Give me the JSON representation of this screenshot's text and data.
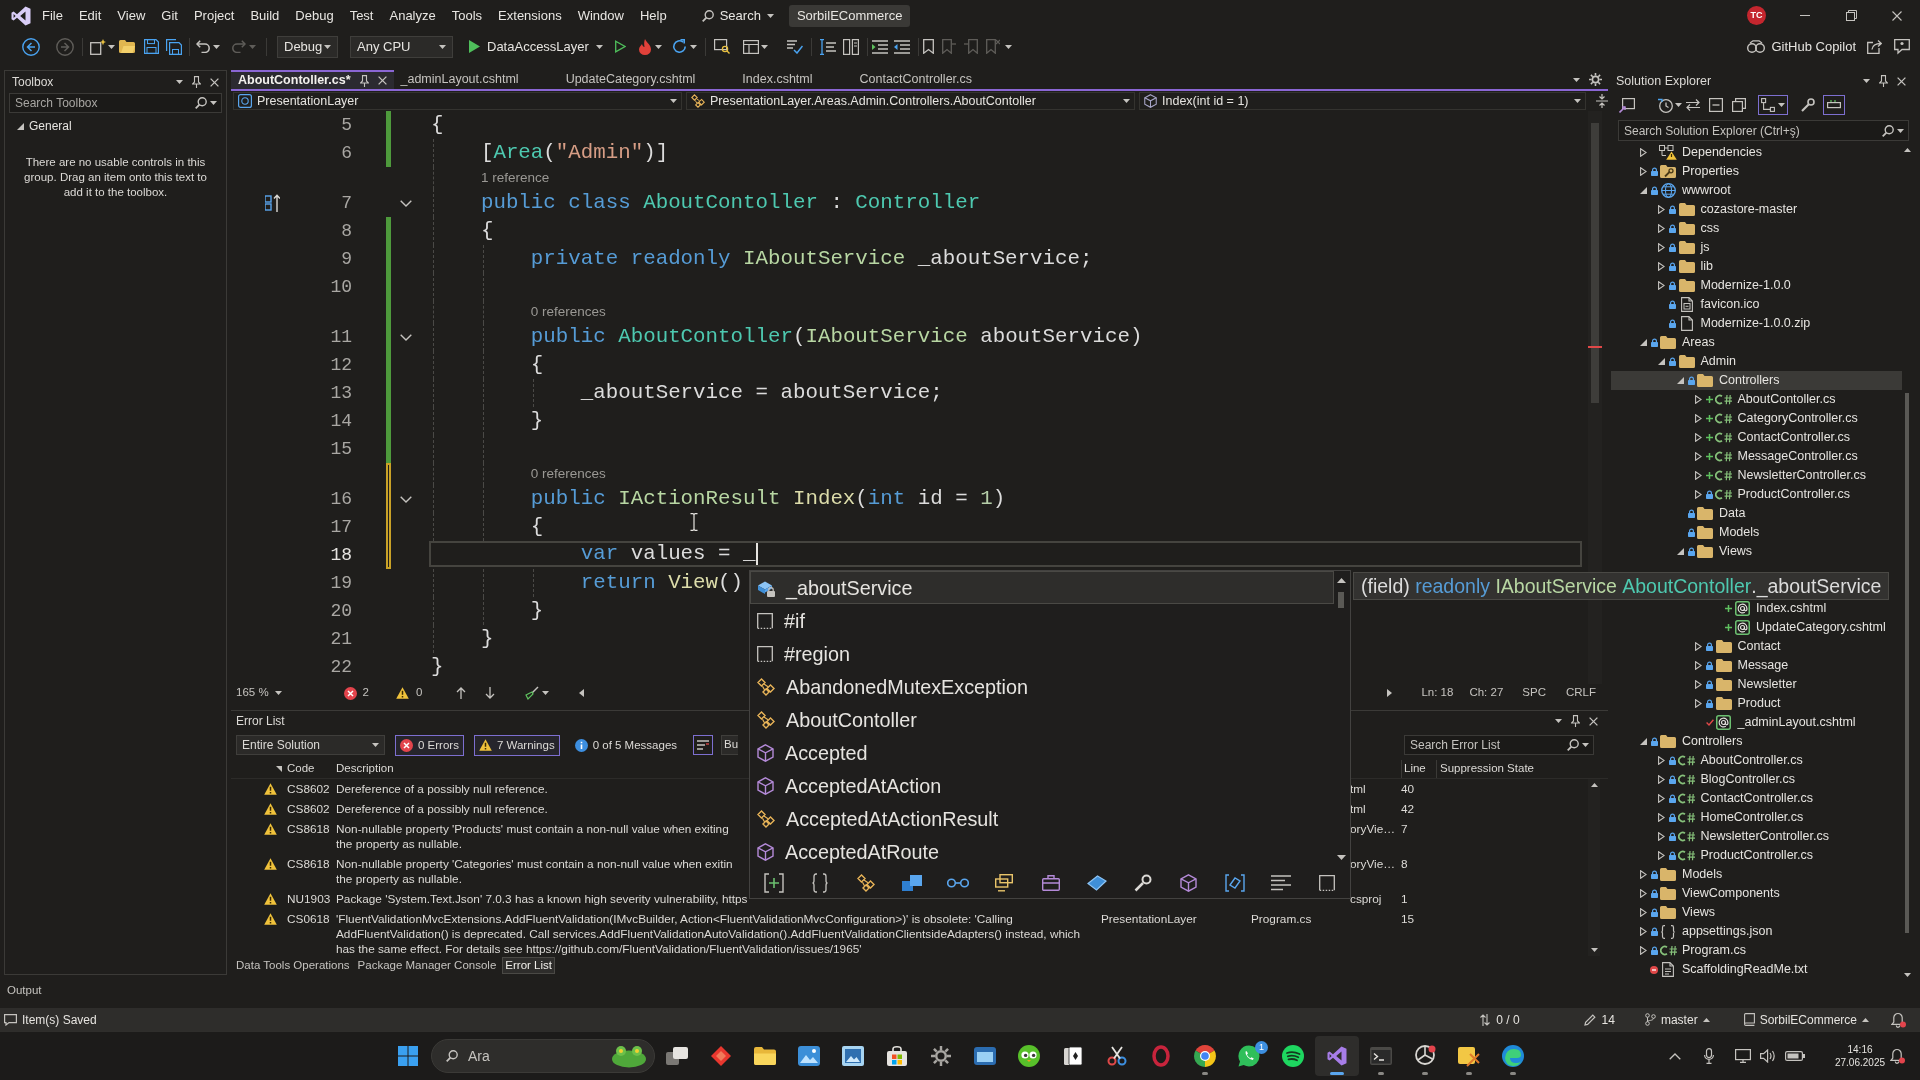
{
  "title_bar": {
    "menu": [
      "File",
      "Edit",
      "View",
      "Git",
      "Project",
      "Build",
      "Debug",
      "Test",
      "Analyze",
      "Tools",
      "Extensions",
      "Window",
      "Help"
    ],
    "search": "Search",
    "solution_name": "SorbilECommerce",
    "account_initials": "TC"
  },
  "toolbar": {
    "configuration": "Debug",
    "platform": "Any CPU",
    "startup_project": "DataAccessLayer",
    "copilot": "GitHub Copilot"
  },
  "toolbox": {
    "title": "Toolbox",
    "search_placeholder": "Search Toolbox",
    "group": {
      "label": "General",
      "expanded": true
    },
    "empty_message": "There are no usable controls in this group. Drag an item onto this text to add it to the toolbox."
  },
  "editor": {
    "tabs": [
      {
        "label": "AboutContoller.cs*",
        "selected": true
      },
      {
        "label": "_adminLayout.cshtml",
        "selected": false
      },
      {
        "label": "UpdateCategory.cshtml",
        "selected": false
      },
      {
        "label": "Index.cshtml",
        "selected": false
      },
      {
        "label": "ContactController.cs",
        "selected": false
      }
    ],
    "navigation": {
      "project": "PresentationLayer",
      "type": "PresentationLayer.Areas.Admin.Controllers.AboutContoller",
      "member": "Index(int id = 1)"
    },
    "lines": [
      {
        "kind": "code",
        "number": "5",
        "changed": true,
        "saved": true,
        "tokens": [
          {
            "text": "{",
            "kind": "plain"
          }
        ]
      },
      {
        "kind": "code",
        "number": "6",
        "changed": true,
        "saved": true,
        "tokens": [
          {
            "text": "    [",
            "kind": "plain"
          },
          {
            "text": "Area",
            "kind": "type"
          },
          {
            "text": "(",
            "kind": "plain"
          },
          {
            "text": "\"Admin\"",
            "kind": "string"
          },
          {
            "text": ")]",
            "kind": "plain"
          }
        ]
      },
      {
        "kind": "codelens",
        "text": "1 reference"
      },
      {
        "kind": "code",
        "number": "7",
        "foldable": true,
        "margin_glyph": true,
        "tokens": [
          {
            "text": "    public class ",
            "kind": "keyword"
          },
          {
            "text": "AboutContoller",
            "kind": "type"
          },
          {
            "text": " : ",
            "kind": "plain"
          },
          {
            "text": "Controller",
            "kind": "type"
          }
        ]
      },
      {
        "kind": "code",
        "number": "8",
        "changed": true,
        "saved": true,
        "tokens": [
          {
            "text": "    {",
            "kind": "plain"
          }
        ]
      },
      {
        "kind": "code",
        "number": "9",
        "changed": true,
        "saved": true,
        "tokens": [
          {
            "text": "        private readonly ",
            "kind": "keyword"
          },
          {
            "text": "IAboutService",
            "kind": "interface"
          },
          {
            "text": " _aboutService;",
            "kind": "plain"
          }
        ]
      },
      {
        "kind": "code",
        "number": "10",
        "changed": true,
        "saved": true
      },
      {
        "kind": "codelens",
        "text": "0 references",
        "changed": true,
        "saved": true
      },
      {
        "kind": "code",
        "number": "11",
        "changed": true,
        "saved": true,
        "foldable": true,
        "tokens": [
          {
            "text": "        public ",
            "kind": "keyword"
          },
          {
            "text": "AboutContoller",
            "kind": "type"
          },
          {
            "text": "(",
            "kind": "plain"
          },
          {
            "text": "IAboutService",
            "kind": "interface"
          },
          {
            "text": " aboutService)",
            "kind": "plain"
          }
        ]
      },
      {
        "kind": "code",
        "number": "12",
        "changed": true,
        "saved": true,
        "tokens": [
          {
            "text": "        {",
            "kind": "plain"
          }
        ]
      },
      {
        "kind": "code",
        "number": "13",
        "changed": true,
        "saved": true,
        "tokens": [
          {
            "text": "            _aboutService = aboutService;",
            "kind": "plain"
          }
        ]
      },
      {
        "kind": "code",
        "number": "14",
        "changed": true,
        "saved": true,
        "tokens": [
          {
            "text": "        }",
            "kind": "plain"
          }
        ]
      },
      {
        "kind": "code",
        "number": "15",
        "changed": true,
        "saved": true
      },
      {
        "kind": "codelens",
        "text": "0 references",
        "changed": true,
        "saved": false
      },
      {
        "kind": "code",
        "number": "16",
        "changed": true,
        "saved": false,
        "foldable": true,
        "tokens": [
          {
            "text": "        public ",
            "kind": "keyword"
          },
          {
            "text": "IActionResult ",
            "kind": "interface"
          },
          {
            "text": "Index",
            "kind": "method"
          },
          {
            "text": "(",
            "kind": "plain"
          },
          {
            "text": "int",
            "kind": "keyword"
          },
          {
            "text": " id = ",
            "kind": "plain"
          },
          {
            "text": "1",
            "kind": "number"
          },
          {
            "text": ")",
            "kind": "plain"
          }
        ]
      },
      {
        "kind": "code",
        "number": "17",
        "changed": true,
        "saved": false,
        "tokens": [
          {
            "text": "        {",
            "kind": "plain"
          }
        ]
      },
      {
        "kind": "code",
        "number": "18",
        "changed": true,
        "saved": false,
        "current": true,
        "tokens": [
          {
            "text": "            var",
            "kind": "keyword"
          },
          {
            "text": " values = _",
            "kind": "plain"
          }
        ]
      },
      {
        "kind": "code",
        "number": "19",
        "tokens": [
          {
            "text": "            return ",
            "kind": "keyword"
          },
          {
            "text": "View",
            "kind": "method"
          },
          {
            "text": "()",
            "kind": "plain"
          }
        ]
      },
      {
        "kind": "code",
        "number": "20",
        "tokens": [
          {
            "text": "        }",
            "kind": "plain"
          }
        ]
      },
      {
        "kind": "code",
        "number": "21",
        "tokens": [
          {
            "text": "    }",
            "kind": "plain"
          }
        ]
      },
      {
        "kind": "code",
        "number": "22",
        "tokens": [
          {
            "text": "}",
            "kind": "plain"
          }
        ]
      }
    ],
    "status": {
      "zoom": "165 %",
      "errors": "2",
      "warnings": "0",
      "line": "Ln: 18",
      "column": "Ch: 27",
      "indentation": "SPC",
      "line_ending": "CRLF"
    }
  },
  "completion": {
    "items": [
      {
        "label": "_aboutService",
        "kind": "field",
        "selected": true
      },
      {
        "label": "#if",
        "kind": "snippet",
        "selected": false
      },
      {
        "label": "#region",
        "kind": "snippet",
        "selected": false
      },
      {
        "label": "AbandonedMutexException",
        "kind": "class",
        "selected": false
      },
      {
        "label": "AboutContoller",
        "kind": "class",
        "selected": false
      },
      {
        "label": "Accepted",
        "kind": "method",
        "selected": false
      },
      {
        "label": "AcceptedAtAction",
        "kind": "method",
        "selected": false
      },
      {
        "label": "AcceptedAtActionResult",
        "kind": "class",
        "selected": false
      },
      {
        "label": "AcceptedAtRoute",
        "kind": "method",
        "selected": false
      }
    ],
    "tooltip": [
      {
        "text": "(field) ",
        "kind": "plain"
      },
      {
        "text": "readonly ",
        "kind": "keyword"
      },
      {
        "text": "IAboutService ",
        "kind": "interface"
      },
      {
        "text": "AboutContoller",
        "kind": "type"
      },
      {
        "text": "._aboutService",
        "kind": "plain"
      }
    ]
  },
  "error_list": {
    "title": "Error List",
    "scope": "Entire Solution",
    "filters": [
      {
        "label": "0 Errors",
        "kind": "error",
        "selected": true
      },
      {
        "label": "7 Warnings",
        "kind": "warning",
        "selected": true
      },
      {
        "label": "0 of 5 Messages",
        "kind": "info",
        "selected": false
      }
    ],
    "source": "Bu",
    "search_placeholder": "Search Error List",
    "columns": [
      "Code",
      "Description",
      "Line",
      "Suppression State"
    ],
    "rows": [
      {
        "kind": "warning",
        "code": "CS8602",
        "description": [
          "Dereference of a possibly null reference."
        ],
        "file": "tml",
        "line": "40"
      },
      {
        "kind": "warning",
        "code": "CS8602",
        "description": [
          "Dereference of a possibly null reference."
        ],
        "file": "tml",
        "line": "42"
      },
      {
        "kind": "warning",
        "code": "CS8618",
        "description": [
          "Non-nullable property 'Products' must contain a non-null value when exiting",
          "the property as nullable."
        ],
        "file": "oryVie…",
        "line": "7"
      },
      {
        "kind": "warning",
        "code": "CS8618",
        "description": [
          "Non-nullable property 'Categories' must contain a non-null value when exitin",
          "the property as nullable."
        ],
        "file": "oryVie…",
        "line": "8"
      },
      {
        "kind": "warning",
        "code": "NU1903",
        "description": [
          "Package 'System.Text.Json' 7.0.3 has a known high severity vulnerability, https"
        ],
        "file": "csproj",
        "line": "1"
      },
      {
        "kind": "warning",
        "code": "CS0618",
        "description": [
          "'FluentValidationMvcExtensions.AddFluentValidation(IMvcBuilder, Action<FluentValidationMvcConfiguration>)' is obsolete: 'Calling",
          "AddFluentValidation() is deprecated. Call services.AddFluentValidationAutoValidation().AddFluentValidationClientsideAdapters() instead, which",
          "has the same effect. For details see https://github.com/FluentValidation/FluentValidation/issues/1965'"
        ],
        "project": "PresentationLayer",
        "file": "Program.cs",
        "line": "15"
      }
    ]
  },
  "bottom_tabs": [
    {
      "label": "Data Tools Operations",
      "selected": false
    },
    {
      "label": "Package Manager Console",
      "selected": false
    },
    {
      "label": "Error List",
      "selected": true
    }
  ],
  "output_tab": "Output",
  "solution_explorer": {
    "title": "Solution Explorer",
    "search_placeholder": "Search Solution Explorer (Ctrl+ş)",
    "tree": [
      {
        "label": "Dependencies",
        "kind": "dependencies",
        "expanded": false,
        "selected": false
      },
      {
        "label": "Properties",
        "kind": "properties",
        "locked": true,
        "expanded": false,
        "selected": false
      },
      {
        "label": "wwwroot",
        "kind": "globe",
        "locked": true,
        "expanded": true,
        "selected": false,
        "children": [
          {
            "label": "cozastore-master",
            "kind": "folder",
            "locked": true,
            "expanded": false,
            "selected": false
          },
          {
            "label": "css",
            "kind": "folder",
            "locked": true,
            "expanded": false,
            "selected": false
          },
          {
            "label": "js",
            "kind": "folder",
            "locked": true,
            "expanded": false,
            "selected": false
          },
          {
            "label": "lib",
            "kind": "folder",
            "locked": true,
            "expanded": false,
            "selected": false
          },
          {
            "label": "Modernize-1.0.0",
            "kind": "folder",
            "locked": true,
            "expanded": false,
            "selected": false
          },
          {
            "label": "favicon.ico",
            "kind": "image",
            "locked": true,
            "selected": false
          },
          {
            "label": "Modernize-1.0.0.zip",
            "kind": "file",
            "locked": true,
            "selected": false
          }
        ]
      },
      {
        "label": "Areas",
        "kind": "folder",
        "locked": true,
        "expanded": true,
        "selected": false,
        "children": [
          {
            "label": "Admin",
            "kind": "folder",
            "locked": true,
            "expanded": true,
            "selected": false,
            "children": [
              {
                "label": "Controllers",
                "kind": "folder",
                "locked": true,
                "expanded": true,
                "selected": true,
                "children": [
                  {
                    "label": "AboutContoller.cs",
                    "kind": "csharp",
                    "added": true,
                    "expanded": false,
                    "selected": false
                  },
                  {
                    "label": "CategoryController.cs",
                    "kind": "csharp",
                    "added": true,
                    "expanded": false,
                    "selected": false
                  },
                  {
                    "label": "ContactController.cs",
                    "kind": "csharp",
                    "added": true,
                    "expanded": false,
                    "selected": false
                  },
                  {
                    "label": "MessageController.cs",
                    "kind": "csharp",
                    "added": true,
                    "expanded": false,
                    "selected": false
                  },
                  {
                    "label": "NewsletterController.cs",
                    "kind": "csharp",
                    "added": true,
                    "expanded": false,
                    "selected": false
                  },
                  {
                    "label": "ProductController.cs",
                    "kind": "csharp",
                    "locked": true,
                    "expanded": false,
                    "selected": false
                  }
                ]
              },
              {
                "label": "Data",
                "kind": "folder",
                "locked": true,
                "selected": false
              },
              {
                "label": "Models",
                "kind": "folder",
                "locked": true,
                "selected": false
              },
              {
                "label": "Views",
                "kind": "folder",
                "locked": true,
                "expanded": true,
                "selected": false,
                "children": [
                  {
                    "children": [
                      {
                        "label": "Index.cshtml",
                        "kind": "razor",
                        "added": true,
                        "selected": false
                      },
                      {
                        "label": "UpdateCategory.cshtml",
                        "kind": "razor",
                        "added": true,
                        "selected": false
                      }
                    ]
                  },
                  {
                    "label": "Contact",
                    "kind": "folder",
                    "locked": true,
                    "expanded": false,
                    "selected": false
                  },
                  {
                    "label": "Message",
                    "kind": "folder",
                    "locked": true,
                    "expanded": false,
                    "selected": false
                  },
                  {
                    "label": "Newsletter",
                    "kind": "folder",
                    "locked": true,
                    "expanded": false,
                    "selected": false
                  },
                  {
                    "label": "Product",
                    "kind": "folder",
                    "locked": true,
                    "expanded": false,
                    "selected": false
                  },
                  {
                    "label": "_adminLayout.cshtml",
                    "kind": "razor",
                    "modified": true,
                    "selected": false
                  }
                ]
              }
            ]
          }
        ]
      },
      {
        "label": "Controllers",
        "kind": "folder",
        "locked": true,
        "expanded": true,
        "selected": false,
        "children": [
          {
            "label": "AboutController.cs",
            "kind": "csharp",
            "locked": true,
            "expanded": false,
            "selected": false
          },
          {
            "label": "BlogController.cs",
            "kind": "csharp",
            "locked": true,
            "expanded": false,
            "selected": false
          },
          {
            "label": "ContactController.cs",
            "kind": "csharp",
            "locked": true,
            "expanded": false,
            "selected": false
          },
          {
            "label": "HomeController.cs",
            "kind": "csharp",
            "locked": true,
            "expanded": false,
            "selected": false
          },
          {
            "label": "NewsletterController.cs",
            "kind": "csharp",
            "locked": true,
            "expanded": false,
            "selected": false
          },
          {
            "label": "ProductController.cs",
            "kind": "csharp",
            "locked": true,
            "expanded": false,
            "selected": false
          }
        ]
      },
      {
        "label": "Models",
        "kind": "folder",
        "locked": true,
        "expanded": false,
        "selected": false
      },
      {
        "label": "ViewComponents",
        "kind": "folder",
        "locked": true,
        "expanded": false,
        "selected": false
      },
      {
        "label": "Views",
        "kind": "folder",
        "locked": true,
        "expanded": false,
        "selected": false
      },
      {
        "label": "appsettings.json",
        "kind": "json",
        "locked": true,
        "expanded": false,
        "selected": false
      },
      {
        "label": "Program.cs",
        "kind": "csharp",
        "locked": true,
        "expanded": false,
        "selected": false
      },
      {
        "label": "ScaffoldingReadMe.txt",
        "kind": "text",
        "excluded": true,
        "selected": false
      }
    ]
  },
  "status_bar": {
    "message": "Item(s) Saved",
    "sync": "0 / 0",
    "pending_changes": "14",
    "branch": "master",
    "repository": "SorbilECommerce"
  },
  "taskbar": {
    "search_placeholder": "Ara",
    "apps": [
      {
        "kind": "taskview",
        "running": false,
        "selected": false
      },
      {
        "kind": "diamond",
        "running": false,
        "selected": false
      },
      {
        "kind": "folder",
        "running": false,
        "selected": false
      },
      {
        "kind": "photos",
        "running": false,
        "selected": false
      },
      {
        "kind": "frame",
        "running": false,
        "selected": false
      },
      {
        "kind": "store",
        "running": false,
        "selected": false
      },
      {
        "kind": "settings",
        "running": false,
        "selected": false
      },
      {
        "kind": "window",
        "running": false,
        "selected": false
      },
      {
        "kind": "owl",
        "running": false,
        "selected": false
      },
      {
        "kind": "cards",
        "running": false,
        "selected": false
      },
      {
        "kind": "snip",
        "running": false,
        "selected": false
      },
      {
        "kind": "ring",
        "running": false,
        "selected": false
      },
      {
        "kind": "browser",
        "running": true,
        "selected": false
      },
      {
        "kind": "chat",
        "running": false,
        "selected": false,
        "badge": "1"
      },
      {
        "kind": "music",
        "running": false,
        "selected": false
      },
      {
        "kind": "ide",
        "running": true,
        "selected": true
      },
      {
        "kind": "terminal",
        "running": true,
        "selected": false
      },
      {
        "kind": "cat",
        "running": true,
        "selected": false
      },
      {
        "kind": "chartapp",
        "running": true,
        "selected": false
      },
      {
        "kind": "swirl",
        "running": true,
        "selected": false
      }
    ],
    "time": "14:16",
    "date": "27.06.2025"
  }
}
